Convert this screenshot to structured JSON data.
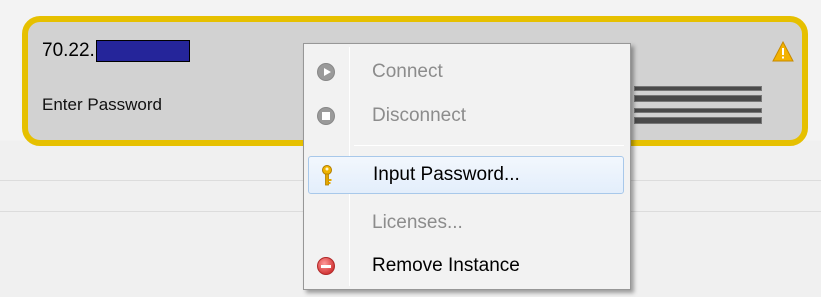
{
  "instance": {
    "ip_prefix": "70.22.",
    "ip_redacted": true,
    "status": "Enter Password",
    "border_color": "#e6c000",
    "warning_icon": "warning-icon"
  },
  "context_menu": {
    "items": [
      {
        "label": "Connect",
        "icon": "play-circle-icon",
        "enabled": false
      },
      {
        "label": "Disconnect",
        "icon": "stop-circle-icon",
        "enabled": false
      },
      {
        "label": "Input Password...",
        "icon": "key-icon",
        "enabled": true,
        "highlighted": true
      },
      {
        "label": "Licenses...",
        "icon": "",
        "enabled": false
      },
      {
        "label": "Remove Instance",
        "icon": "remove-icon",
        "enabled": true
      }
    ]
  }
}
